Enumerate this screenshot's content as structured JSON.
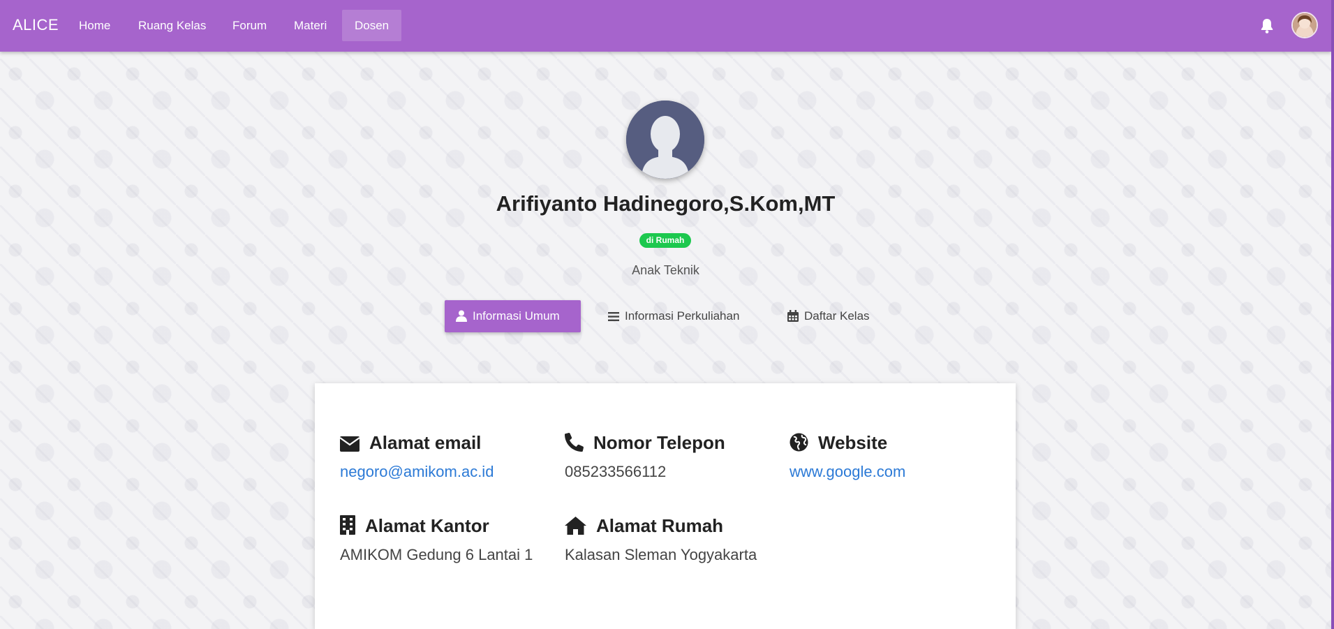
{
  "navbar": {
    "brand": "ALICE",
    "items": [
      {
        "label": "Home",
        "active": false
      },
      {
        "label": "Ruang Kelas",
        "active": false
      },
      {
        "label": "Forum",
        "active": false
      },
      {
        "label": "Materi",
        "active": false
      },
      {
        "label": "Dosen",
        "active": true
      }
    ],
    "icons": [
      "bell-icon",
      "user-avatar"
    ],
    "color": "#a664cc"
  },
  "profile": {
    "name": "Arifiyanto Hadinegoro,S.Kom,MT",
    "status_badge": "di Rumah",
    "status_color": "#1cc84e",
    "subtitle": "Anak Teknik"
  },
  "tabs": [
    {
      "label": "Informasi Umum",
      "icon": "user-icon",
      "active": true
    },
    {
      "label": "Informasi Perkuliahan",
      "icon": "list-icon",
      "active": false
    },
    {
      "label": "Daftar Kelas",
      "icon": "calendar-icon",
      "active": false
    }
  ],
  "info": {
    "email": {
      "title": "Alamat email",
      "value": "negoro@amikom.ac.id",
      "icon": "envelope-icon"
    },
    "phone": {
      "title": "Nomor Telepon",
      "value": "085233566112",
      "icon": "phone-icon"
    },
    "website": {
      "title": "Website",
      "value": "www.google.com",
      "icon": "globe-icon"
    },
    "office": {
      "title": "Alamat Kantor",
      "value": "AMIKOM Gedung 6 Lantai 1",
      "icon": "building-icon"
    },
    "home": {
      "title": "Alamat Rumah",
      "value": "Kalasan Sleman Yogyakarta",
      "icon": "home-icon"
    }
  }
}
